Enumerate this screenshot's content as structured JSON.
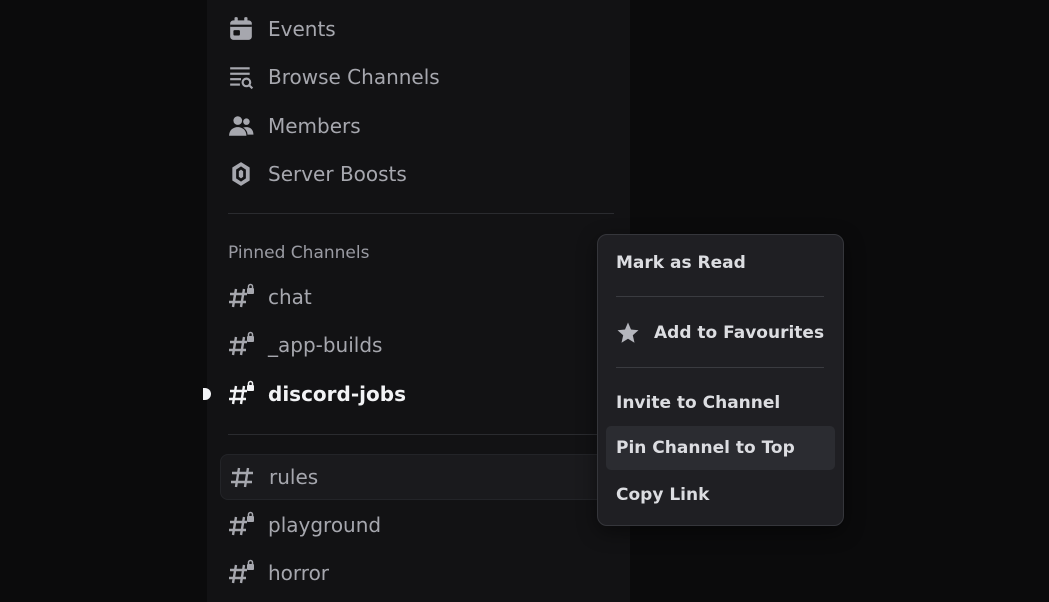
{
  "sidebar": {
    "nav": [
      {
        "label": "Events",
        "icon": "calendar-icon"
      },
      {
        "label": "Browse Channels",
        "icon": "browse-channels-icon"
      },
      {
        "label": "Members",
        "icon": "members-icon"
      },
      {
        "label": "Server Boosts",
        "icon": "boost-gem-icon"
      }
    ],
    "pinned_label": "Pinned Channels",
    "pinned": [
      {
        "name": "chat",
        "icon": "locked-hash-icon"
      },
      {
        "name": "_app-builds",
        "icon": "locked-hash-icon"
      },
      {
        "name": "discord-jobs",
        "icon": "locked-hash-icon",
        "unread": true
      }
    ],
    "channels": [
      {
        "name": "rules",
        "icon": "hash-icon"
      },
      {
        "name": "playground",
        "icon": "locked-hash-icon"
      },
      {
        "name": "horror",
        "icon": "locked-hash-icon"
      }
    ]
  },
  "context_menu": {
    "mark_read": "Mark as Read",
    "favourite": "Add to Favourites",
    "invite": "Invite to Channel",
    "pin": "Pin Channel to Top",
    "copy_link": "Copy Link"
  },
  "colors": {
    "background": "#0b0b0c",
    "sidebar": "#121214",
    "menu": "#1f1f23",
    "text": "#a6a7ae",
    "active_text": "#f2f3f5"
  }
}
